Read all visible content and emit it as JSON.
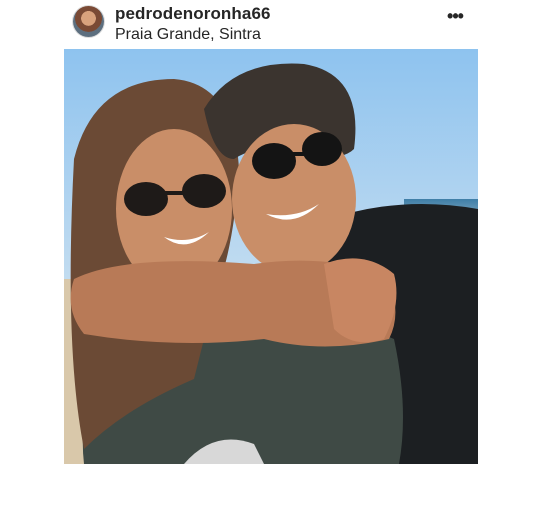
{
  "post": {
    "username": "pedrodenoronha66",
    "location": "Praia Grande, Sintra",
    "more_icon": "more-horizontal-icon"
  },
  "photo": {
    "subject": "couple selfie on beach",
    "colors": {
      "sky": "#9fcbef",
      "sea": "#3f7ea7",
      "shirt_green": "#3f4a45",
      "shirt_black": "#1c1f22",
      "skin": "#c98e68",
      "hair_woman": "#6b4a35",
      "hair_man": "#3b342f"
    }
  }
}
